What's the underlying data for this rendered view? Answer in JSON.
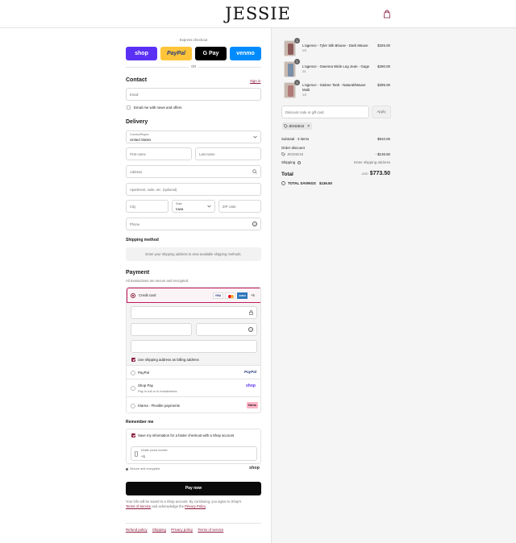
{
  "header": {
    "logo": "JESSIE",
    "cart_icon": "bag-icon"
  },
  "express": {
    "label": "Express checkout",
    "buttons": [
      {
        "label": "shop",
        "bg": "#5a31f4",
        "color": "#ffffff"
      },
      {
        "label": "PayPal",
        "bg": "#ffc439",
        "color": "#253b80"
      },
      {
        "label": "G Pay",
        "bg": "#000000",
        "color": "#ffffff"
      },
      {
        "label": "venmo",
        "bg": "#008cff",
        "color": "#ffffff"
      }
    ],
    "or": "OR"
  },
  "contact": {
    "title": "Contact",
    "sign_in": "Sign in",
    "email_placeholder": "Email",
    "newsletter_label": "Email me with news and offers"
  },
  "delivery": {
    "title": "Delivery",
    "country_label": "Country/Region",
    "country_value": "United States",
    "first_name": "First name",
    "last_name": "Last name",
    "address": "Address",
    "apartment": "Apartment, suite, etc. (optional)",
    "city": "City",
    "state_label": "State",
    "state_value": "Iowa",
    "zip": "ZIP code",
    "phone": "Phone"
  },
  "shipping_method": {
    "title": "Shipping method",
    "notice": "Enter your shipping address to view available shipping methods."
  },
  "payment": {
    "title": "Payment",
    "subtitle": "All transactions are secure and encrypted.",
    "credit_card_label": "Credit card",
    "card_brands": [
      "VISA",
      "MC",
      "AMEX"
    ],
    "more_brands": "+5",
    "billing_same_label": "Use shipping address as billing address",
    "options": [
      {
        "label": "PayPal",
        "sub": "",
        "badge": "PayPal"
      },
      {
        "label": "Shop Pay",
        "sub": "Pay in full or in installments",
        "badge": "shop"
      },
      {
        "label": "Klarna - Flexible payments",
        "sub": "",
        "badge": "Klarna."
      }
    ]
  },
  "remember": {
    "title": "Remember me",
    "save_label": "Save my information for a faster checkout with a Shop account",
    "phone_label": "Mobile phone number",
    "phone_value": "+1",
    "secure": "Secure and encrypted",
    "shop_brand": "shop"
  },
  "pay_now": "Pay now",
  "legal": {
    "text": "Your info will be saved to a Shop account. By continuing, you agree to Shop's",
    "terms": "Terms of Service",
    "and": "and acknowledge the",
    "privacy": "Privacy Policy",
    "period": "."
  },
  "footer_links": [
    "Refund policy",
    "Shipping",
    "Privacy policy",
    "Terms of service"
  ],
  "order": {
    "items": [
      {
        "name": "L'agence - Tyler Silk Blouse - Dark Mauve",
        "variant": "XS",
        "qty": "1",
        "price": "$325.00"
      },
      {
        "name": "L'agence - Gwenna Wide Leg Jean - Gage",
        "variant": "24",
        "qty": "1",
        "price": "$290.00"
      },
      {
        "name": "L'agence - Galene Tank - Natural/Mauve Multi",
        "variant": "XS",
        "qty": "1",
        "price": "$295.00"
      }
    ],
    "discount_placeholder": "Discount code or gift card",
    "apply": "Apply",
    "applied_code": "JESSIE15",
    "subtotal_label": "Subtotal · 3 items",
    "subtotal_value": "$910.00",
    "order_discount_label": "Order discount",
    "discount_code": "JESSIE15",
    "discount_value": "- $136.50",
    "shipping_label": "Shipping",
    "shipping_value": "Enter shipping address",
    "total_label": "Total",
    "currency": "USD",
    "total_value": "$773.50",
    "savings_label": "TOTAL SAVINGS",
    "savings_value": "$136.50"
  },
  "colors": {
    "accent": "#8a1a3b",
    "error_border": "#c2185b",
    "panel": "#f5f5f5"
  }
}
